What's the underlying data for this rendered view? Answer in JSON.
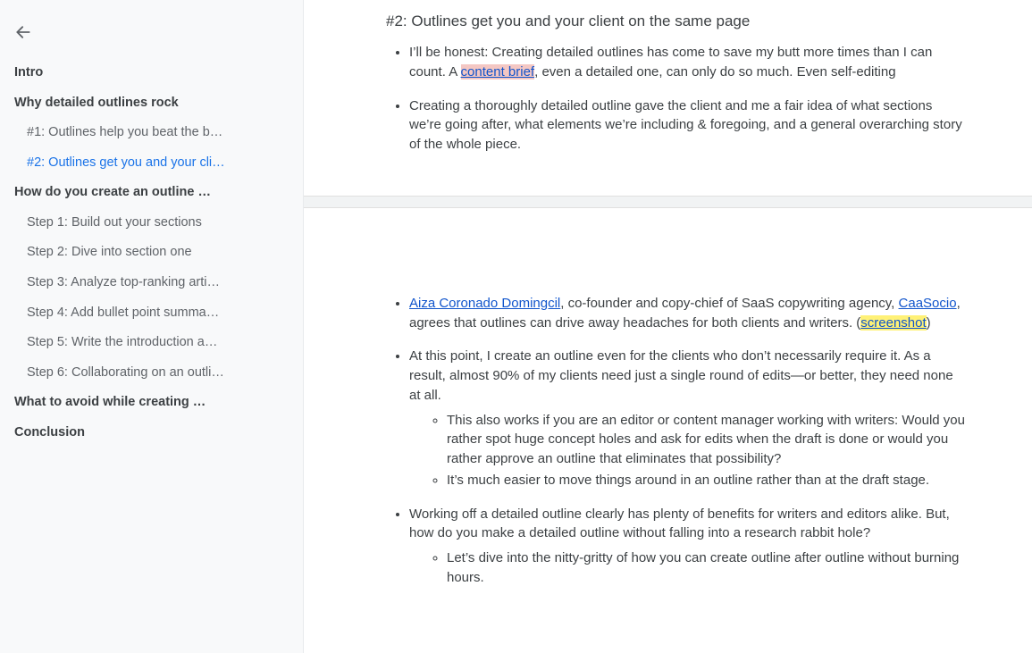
{
  "sidebar": {
    "items": [
      {
        "label": "Intro",
        "level": 1,
        "active": false
      },
      {
        "label": "Why detailed outlines rock",
        "level": 1,
        "active": false
      },
      {
        "label": "#1: Outlines help you beat the b…",
        "level": 2,
        "active": false
      },
      {
        "label": "#2: Outlines get you and your cli…",
        "level": 2,
        "active": true
      },
      {
        "label": "How do you create an outline …",
        "level": 1,
        "active": false
      },
      {
        "label": "Step 1: Build out your sections",
        "level": 2,
        "active": false
      },
      {
        "label": "Step 2: Dive into section one",
        "level": 2,
        "active": false
      },
      {
        "label": "Step 3: Analyze top-ranking arti…",
        "level": 2,
        "active": false
      },
      {
        "label": "Step 4: Add bullet point summa…",
        "level": 2,
        "active": false
      },
      {
        "label": "Step 5: Write the introduction a…",
        "level": 2,
        "active": false
      },
      {
        "label": "Step 6: Collaborating on an outli…",
        "level": 2,
        "active": false
      },
      {
        "label": "What to avoid while creating …",
        "level": 1,
        "active": false
      },
      {
        "label": "Conclusion",
        "level": 1,
        "active": false
      }
    ]
  },
  "document": {
    "heading": "#2: Outlines get you and your client on the same page",
    "p1": {
      "pre": "I’ll be honest: Creating detailed outlines has come to save my butt more times than I can count. A ",
      "link": "content brief",
      "post": ", even a detailed one, can only do so much. Even self-editing"
    },
    "p2": "Creating a thoroughly detailed outline gave the client and me a fair idea of what sections we’re going after, what elements we’re including & foregoing, and a general overarching story of the whole piece.",
    "p3": {
      "link1": "Aiza Coronado Domingcil",
      "mid1": ", co-founder and copy-chief of SaaS copywriting agency, ",
      "link2": "CaaSocio",
      "mid2": ", agrees that outlines can drive away headaches for both clients and writers. (",
      "hl_link": "screenshot",
      "end": ")"
    },
    "p4": "At this point, I create an outline even for the clients who don’t necessarily require it. As a result, almost 90% of my clients need just a single round of edits—or better, they need none at all.",
    "p4_sub1": "This also works if you are an editor or content manager working with writers: Would you rather spot huge concept holes and ask for edits when the draft is done or would you rather approve an outline that eliminates that possibility?",
    "p4_sub2": "It’s much easier to move things around in an outline rather than at the draft stage.",
    "p5": "Working off a detailed outline clearly has plenty of benefits for writers and editors alike. But, how do you make a detailed outline without falling into a research rabbit hole?",
    "p5_sub1": "Let’s dive into the nitty-gritty of how you can create outline after outline without burning hours."
  }
}
